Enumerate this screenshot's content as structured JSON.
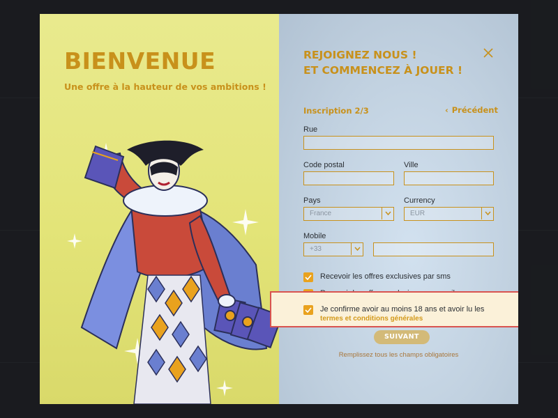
{
  "left": {
    "title": "BIENVENUE",
    "subtitle": "Une offre à la hauteur de vos ambitions !",
    "illustration": "harlequin-jester-card-illustration"
  },
  "right": {
    "title_line1": "REJOIGNEZ NOUS !",
    "title_line2": "ET COMMENCEZ À JOUER !",
    "close_icon": "close-icon",
    "step": "Inscription 2/3",
    "prev": "Précédent",
    "fields": {
      "street": {
        "label": "Rue",
        "value": ""
      },
      "postal": {
        "label": "Code postal",
        "value": ""
      },
      "city": {
        "label": "Ville",
        "value": ""
      },
      "country": {
        "label": "Pays",
        "value": "France"
      },
      "currency": {
        "label": "Currency",
        "value": "EUR"
      },
      "mobile": {
        "label": "Mobile",
        "prefix": "+33",
        "value": ""
      }
    },
    "checkboxes": [
      {
        "label": "Recevoir les offres exclusives par sms",
        "checked": true
      },
      {
        "label": "Recevoir les offres exclusives par email",
        "checked": true
      },
      {
        "label": "Je confirme avoir au moins 18 ans et avoir lu les",
        "link": "termes et conditions générales",
        "checked": true
      }
    ],
    "submit": "SUIVANT",
    "note": "Remplissez tous les champs obligatoires"
  },
  "colors": {
    "accent": "#c8911b",
    "checkbox": "#e9a21e",
    "highlight_border": "#d9534f"
  }
}
